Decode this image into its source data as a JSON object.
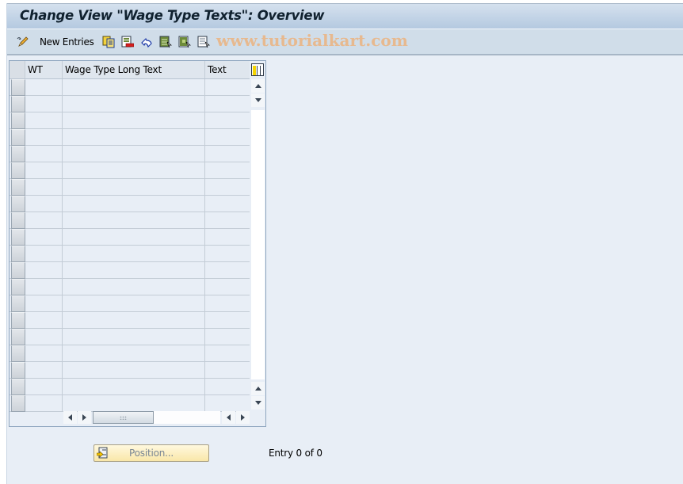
{
  "window": {
    "title": "Change View \"Wage Type Texts\": Overview"
  },
  "toolbar": {
    "items": [
      {
        "icon": "display-change-icon",
        "label": ""
      },
      {
        "icon": "new-entries-label",
        "label": "New Entries"
      },
      {
        "icon": "copy-as-icon",
        "label": ""
      },
      {
        "icon": "delete-icon",
        "label": ""
      },
      {
        "icon": "undo-change-icon",
        "label": ""
      },
      {
        "icon": "select-all-icon",
        "label": ""
      },
      {
        "icon": "select-block-icon",
        "label": ""
      },
      {
        "icon": "deselect-all-icon",
        "label": ""
      }
    ],
    "watermark": "www.tutorialkart.com"
  },
  "table": {
    "columns": [
      {
        "key": "wt",
        "label": "WT"
      },
      {
        "key": "long_text",
        "label": "Wage Type Long Text"
      },
      {
        "key": "text",
        "label": "Text"
      }
    ],
    "rows": [
      {
        "wt": "",
        "long_text": "",
        "text": ""
      },
      {
        "wt": "",
        "long_text": "",
        "text": ""
      },
      {
        "wt": "",
        "long_text": "",
        "text": ""
      },
      {
        "wt": "",
        "long_text": "",
        "text": ""
      },
      {
        "wt": "",
        "long_text": "",
        "text": ""
      },
      {
        "wt": "",
        "long_text": "",
        "text": ""
      },
      {
        "wt": "",
        "long_text": "",
        "text": ""
      },
      {
        "wt": "",
        "long_text": "",
        "text": ""
      },
      {
        "wt": "",
        "long_text": "",
        "text": ""
      },
      {
        "wt": "",
        "long_text": "",
        "text": ""
      },
      {
        "wt": "",
        "long_text": "",
        "text": ""
      },
      {
        "wt": "",
        "long_text": "",
        "text": ""
      },
      {
        "wt": "",
        "long_text": "",
        "text": ""
      },
      {
        "wt": "",
        "long_text": "",
        "text": ""
      },
      {
        "wt": "",
        "long_text": "",
        "text": ""
      },
      {
        "wt": "",
        "long_text": "",
        "text": ""
      },
      {
        "wt": "",
        "long_text": "",
        "text": ""
      },
      {
        "wt": "",
        "long_text": "",
        "text": ""
      },
      {
        "wt": "",
        "long_text": "",
        "text": ""
      },
      {
        "wt": "",
        "long_text": "",
        "text": ""
      }
    ]
  },
  "footer": {
    "position_button": "Position...",
    "entry_info": "Entry 0 of 0"
  },
  "colors": {
    "title_text": "#10212f",
    "watermark": "#e7b98f",
    "position_button_bg": "#f9e7a9"
  }
}
